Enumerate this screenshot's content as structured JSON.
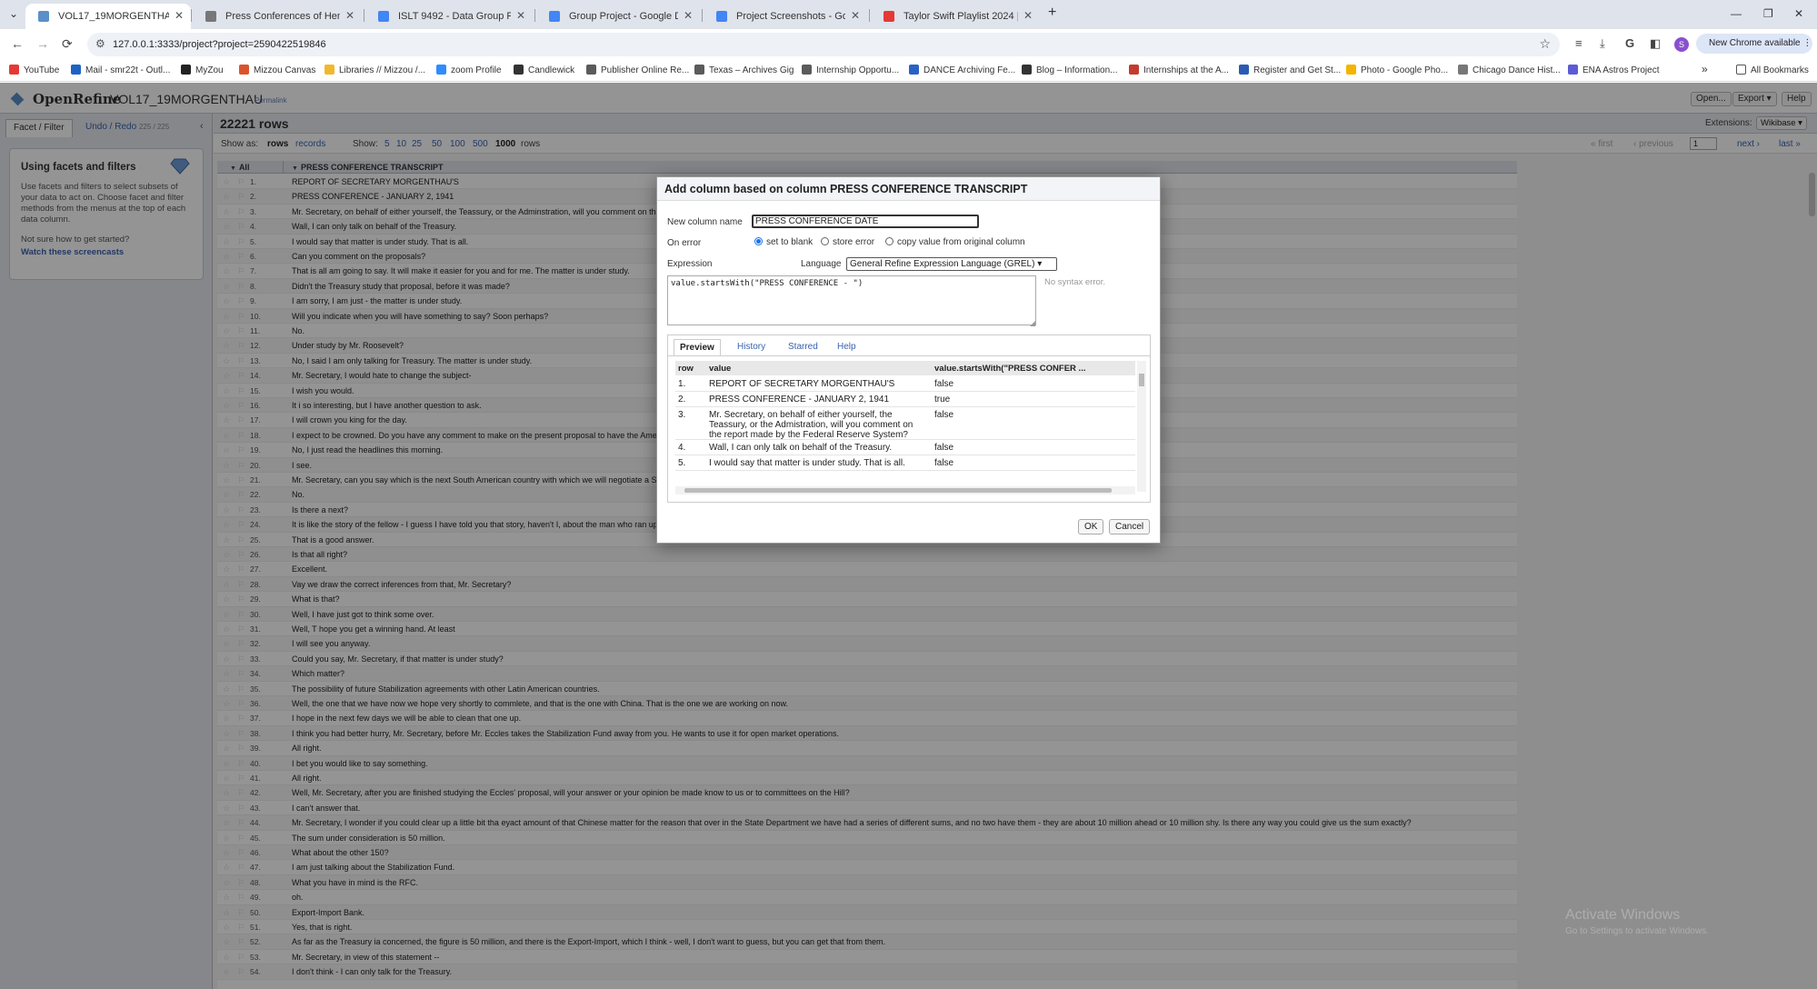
{
  "browser": {
    "tabs": [
      {
        "title": "VOL17_19MORGENTHAU - Ope",
        "color": "#5b8fc7"
      },
      {
        "title": "Press Conferences of Henry Mo",
        "color": "#777777"
      },
      {
        "title": "ISLT 9492 - Data Group Paper d",
        "color": "#4285f4"
      },
      {
        "title": "Group Project - Google Docs",
        "color": "#4285f4"
      },
      {
        "title": "Project Screenshots - Google D",
        "color": "#4285f4"
      },
      {
        "title": "Taylor Swift Playlist 2024 | T",
        "color": "#e53935"
      }
    ],
    "url": "127.0.0.1:3333/project?project=2590422519846",
    "new_chrome": "New Chrome available",
    "profile_initial": "S",
    "bookmarks": [
      {
        "label": "YouTube",
        "color": "#e53935"
      },
      {
        "label": "Mail - smr22t - Outl...",
        "color": "#1e63c4"
      },
      {
        "label": "MyZou",
        "color": "#222222"
      },
      {
        "label": "Mizzou Canvas",
        "color": "#d9542b"
      },
      {
        "label": "Libraries // Mizzou /...",
        "color": "#f1b82d"
      },
      {
        "label": "zoom Profile",
        "color": "#2d8cff"
      },
      {
        "label": "Candlewick",
        "color": "#333333"
      },
      {
        "label": "Publisher Online Re...",
        "color": "#5b5b5b"
      },
      {
        "label": "Texas – Archives Gig",
        "color": "#5b5b5b"
      },
      {
        "label": "Internship Opportu...",
        "color": "#5b5b5b"
      },
      {
        "label": "DANCE Archiving Fe...",
        "color": "#2962c4"
      },
      {
        "label": "Blog – Information...",
        "color": "#333333"
      },
      {
        "label": "Internships at the A...",
        "color": "#c43b2f"
      },
      {
        "label": "Register and Get St...",
        "color": "#2a5bb3"
      },
      {
        "label": "Photo - Google Pho...",
        "color": "#f4b400"
      },
      {
        "label": "Chicago Dance Hist...",
        "color": "#777777"
      },
      {
        "label": "ENA Astros Project",
        "color": "#5b5bd6"
      }
    ],
    "more_bookmarks": "»",
    "all_bookmarks": "All Bookmarks"
  },
  "app": {
    "brand": "OpenRefine",
    "project_name": "VOL17_19MORGENTHAU",
    "permalink": "Permalink",
    "header_buttons": [
      "Open...",
      "Export ▾",
      "Help"
    ],
    "left_tabs": {
      "facet": "Facet / Filter",
      "undo": "Undo / Redo",
      "undo_count": "225 / 225"
    },
    "help": {
      "title": "Using facets and filters",
      "para1": "Use facets and filters to select subsets of your data to act on. Choose facet and filter methods from the menus at the top of each data column.",
      "para2": "Not sure how to get started?",
      "link": "Watch these screencasts"
    },
    "row_count": "22221 rows",
    "extensions_label": "Extensions:",
    "wikibase_btn": "Wikibase ▾",
    "show_as": "Show as:",
    "show_rows": "rows",
    "show_records": "records",
    "show": "Show:",
    "page_sizes": [
      "5",
      "10",
      "25",
      "50",
      "100",
      "500",
      "1000"
    ],
    "rows_word": "rows",
    "pager": {
      "first": "« first",
      "previous": "‹ previous",
      "page": "1",
      "next": "next ›",
      "last": "last »"
    },
    "columns": {
      "all": "All",
      "transcript": "PRESS CONFERENCE TRANSCRIPT"
    },
    "rows": [
      "REPORT OF SECRETARY MORGENTHAU'S",
      "PRESS CONFERENCE - JANUARY 2, 1941",
      "Mr. Secretary, on behalf of either yourself, the Teassury, or the Adminstration, will you comment on the repo",
      "Wall, I can only talk on behalf of the Treasury.",
      "I would say that matter is under study. That is all.",
      "Can you comment on the proposals?",
      "That is all am going to say. It will make it easier for you and for me. The matter is under study.",
      "Didn't the Treasury study that proposal, before it was made?",
      "I am sorry, I am just - the matter is under study.",
      "Will you indicate when you will have something to say? Soon perhaps?",
      "No.",
      "Under study by Mr. Roosevelt?",
      "No, I said I am only talking for Treasury. The matter is under study.",
      "Mr. Secretary, I would hate to change the subject-",
      "I wish you would.",
      "It i so interesting, but I have another question to ask.",
      "I will crown you king for the day.",
      "I expect to be crowned. Do you have any comment to make on the present proposal to have the American to",
      "No, I just read the headlines this morning.",
      "I see.",
      "Mr. Secretary, can you say which is the next South American country with which we will negotiate a Stabiliz",
      "No.",
      "Is there a next?",
      "It is like the story of the fellow - I guess I have told you that story, haven't I, about the man who ran up to the",
      "That is a good answer.",
      "Is that all right?",
      "Excellent.",
      "Vay we draw the correct inferences from that, Mr. Secretary?",
      "What is that?",
      "Well, I have just got to think some over.",
      "Well, T hope you get a winning hand. At least",
      "I will see you anyway.",
      "Could you say, Mr. Secretary, if that matter is under study?",
      "Which matter?",
      "The possibility of future Stabilization agreements with other Latin American countries.",
      "Well, the one that we have now we hope very shortly to commlete, and that is the one with China. That is the one we are working on now.",
      "I hope in the next few days we will be able to clean that one up.",
      "I think you had better hurry, Mr. Secretary, before Mr. Eccles takes the Stabilization Fund away from you. He wants to use it for open market operations.",
      "All right.",
      "I bet you would like to say something.",
      "All right.",
      "Well, Mr. Secretary, after you are finished studying the Eccles' proposal, will your answer or your opinion be made know to us or to committees on the Hill?",
      "I can't answer that.",
      "Mr. Secretary, I wonder if you could clear up a little bit tha eyact amount of that Chinese matter for the reason that over in the State Department we have had a series of different sums, and no two have them - they are about 10 million ahead or 10 million shy. Is there any way you could give us the sum exactly?",
      "The sum under consideration is 50 million.",
      "What about the other 150?",
      "I am just talking about the Stabilization Fund.",
      "What you have in mind is the RFC.",
      "oh.",
      "Export-Import Bank.",
      "Yes, that is right.",
      "As far as the Treasury ia concerned, the figure is 50 million, and there is the Export-Import, which I think - well, I don't want to guess, but you can get that from them.",
      "Mr. Secretary, in view of this statement --",
      "I don't think - I can only talk for the Treasury."
    ]
  },
  "dialog": {
    "title": "Add column based on column PRESS CONFERENCE TRANSCRIPT",
    "new_column_label": "New column name",
    "new_column_value": "PRESS CONFERENCE DATE",
    "on_error_label": "On error",
    "on_error_options": [
      "set to blank",
      "store error",
      "copy value from original column"
    ],
    "expression_label": "Expression",
    "language_label": "Language",
    "language_value": "General Refine Expression Language (GREL) ▾",
    "expression": "value.startsWith(\"PRESS CONFERENCE - \")",
    "syntax_status": "No syntax error.",
    "tabs": [
      "Preview",
      "History",
      "Starred",
      "Help"
    ],
    "preview_headers": [
      "row",
      "value",
      "value.startsWith(\"PRESS CONFER ..."
    ],
    "preview_rows": [
      {
        "row": "1.",
        "value": "REPORT OF SECRETARY MORGENTHAU'S",
        "result": "false"
      },
      {
        "row": "2.",
        "value": "PRESS CONFERENCE - JANUARY 2, 1941",
        "result": "true"
      },
      {
        "row": "3.",
        "value": "Mr. Secretary, on behalf of either yourself, the Teassury, or the Admistration, will you comment on the report made by the Federal Reserve System?",
        "result": "false"
      },
      {
        "row": "4.",
        "value": "Wall, I can only talk on behalf of the Treasury.",
        "result": "false"
      },
      {
        "row": "5.",
        "value": "I would say that matter is under study. That is all.",
        "result": "false"
      }
    ],
    "ok": "OK",
    "cancel": "Cancel"
  },
  "watermark": {
    "title": "Activate Windows",
    "sub": "Go to Settings to activate Windows."
  }
}
